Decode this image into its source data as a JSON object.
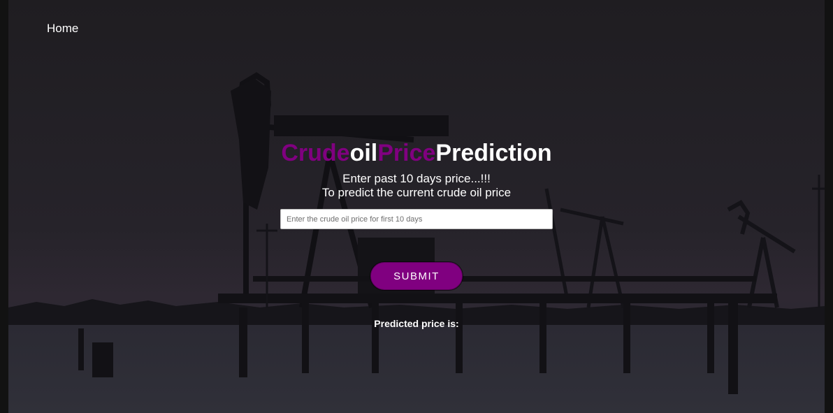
{
  "nav": {
    "home_label": "Home"
  },
  "header": {
    "title_parts": [
      "Crude",
      "oil",
      "Price",
      "Prediction"
    ],
    "subtitle_line1": "Enter past 10 days price...!!!",
    "subtitle_line2": "To predict the current crude oil price"
  },
  "form": {
    "input_value": "",
    "input_placeholder": "Enter the crude oil price for first 10 days",
    "submit_label": "SUBMIT"
  },
  "result": {
    "label": "Predicted price is:"
  },
  "colors": {
    "accent": "#800080",
    "text": "#ffffff",
    "background": "#121212"
  },
  "background_image": "oil-pumpjacks-at-dusk-in-snow"
}
